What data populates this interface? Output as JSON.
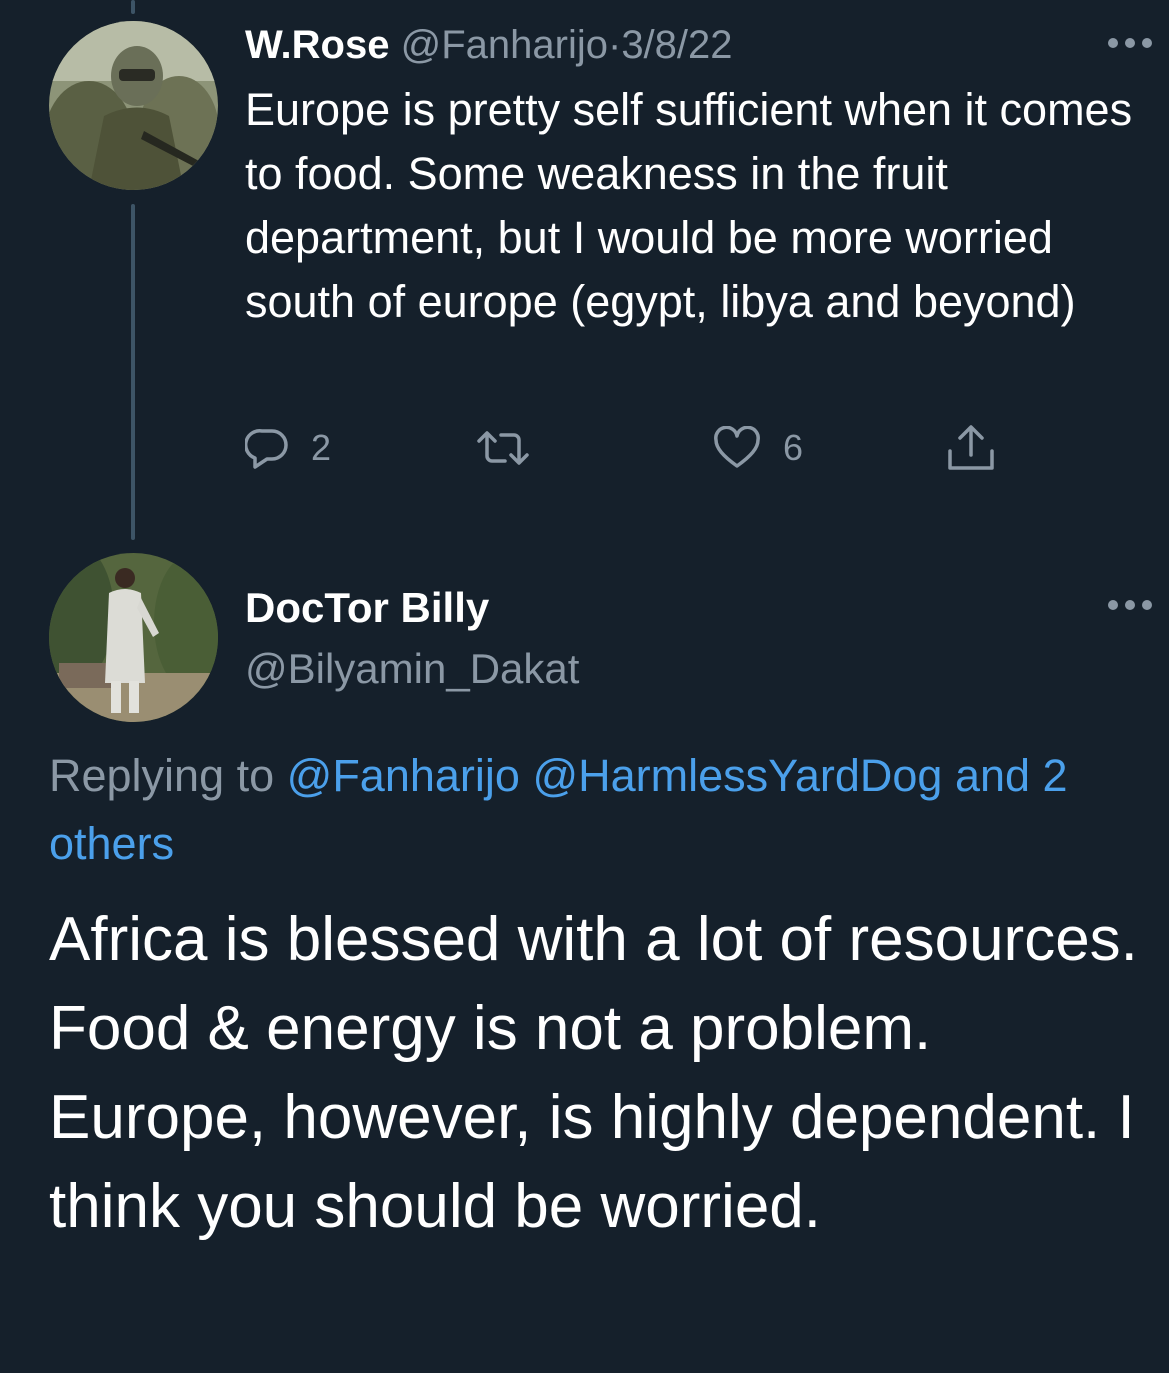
{
  "tweet1": {
    "name": "W.Rose",
    "handle": "@Fanharijo",
    "separator": "·",
    "date": "3/8/22",
    "text": "Europe is pretty self sufficient when it comes to food. Some weakness in the fruit department, but I would be more worried south of europe (egypt, libya and beyond)",
    "reply_count": "2",
    "retweet_count": "",
    "like_count": "6",
    "avatar_icon": "avatar-soldier-photo"
  },
  "tweet2": {
    "name": "DocTor Billy",
    "handle": "@Bilyamin_Dakat",
    "replying_prefix": "Replying to ",
    "replying_mention1": "@Fanharijo",
    "replying_mention2": "@HarmlessYardDog",
    "replying_others": "and 2 others",
    "text": "Africa is blessed with a lot of resources. Food & energy is not a problem. Europe, however, is highly dependent. I think you should be worried.",
    "avatar_icon": "avatar-person-photo"
  },
  "colors": {
    "background": "#15202b",
    "text": "#ffffff",
    "muted": "#8b98a5",
    "link": "#4ba0eb",
    "thread_line": "#3d5466"
  }
}
